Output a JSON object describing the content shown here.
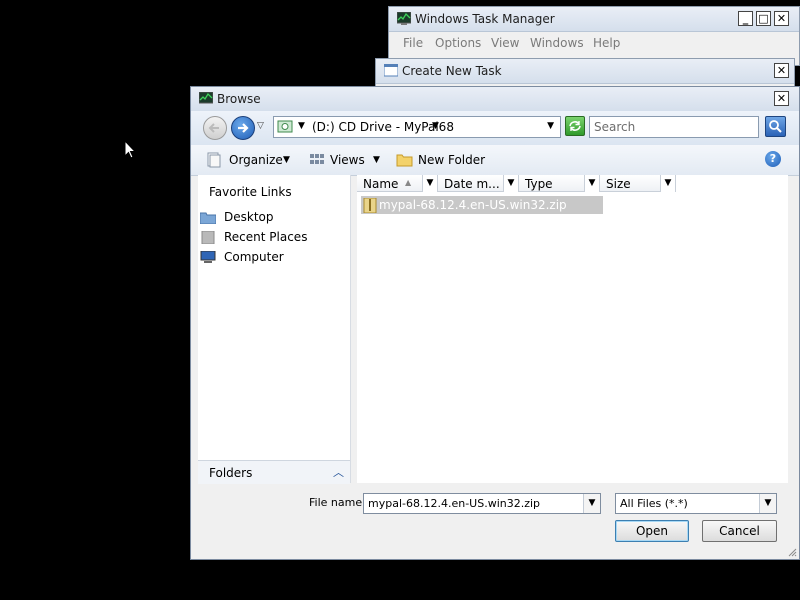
{
  "task_manager": {
    "title": "Windows Task Manager",
    "menu": [
      "File",
      "Options",
      "View",
      "Windows",
      "Help"
    ]
  },
  "create_new_task": {
    "title": "Create New Task"
  },
  "browse": {
    "title": "Browse",
    "address": "(D:) CD Drive - MyPal68",
    "search_placeholder": "Search",
    "commands": {
      "organize": "Organize",
      "views": "Views",
      "new_folder": "New Folder"
    },
    "favorites": {
      "header": "Favorite Links",
      "items": [
        "Desktop",
        "Recent Places",
        "Computer"
      ]
    },
    "folders_label": "Folders",
    "columns": [
      "Name",
      "Date m...",
      "Type",
      "Size"
    ],
    "files": [
      "mypal-68.12.4.en-US.win32.zip"
    ],
    "file_name_label": "File name:",
    "file_name_value": "mypal-68.12.4.en-US.win32.zip",
    "file_type_value": "All Files (*.*)",
    "open_label": "Open",
    "cancel_label": "Cancel"
  },
  "colors": {
    "accent": "#2a6fc9",
    "title_bar": "#dbe5f1",
    "background": "#000000"
  }
}
